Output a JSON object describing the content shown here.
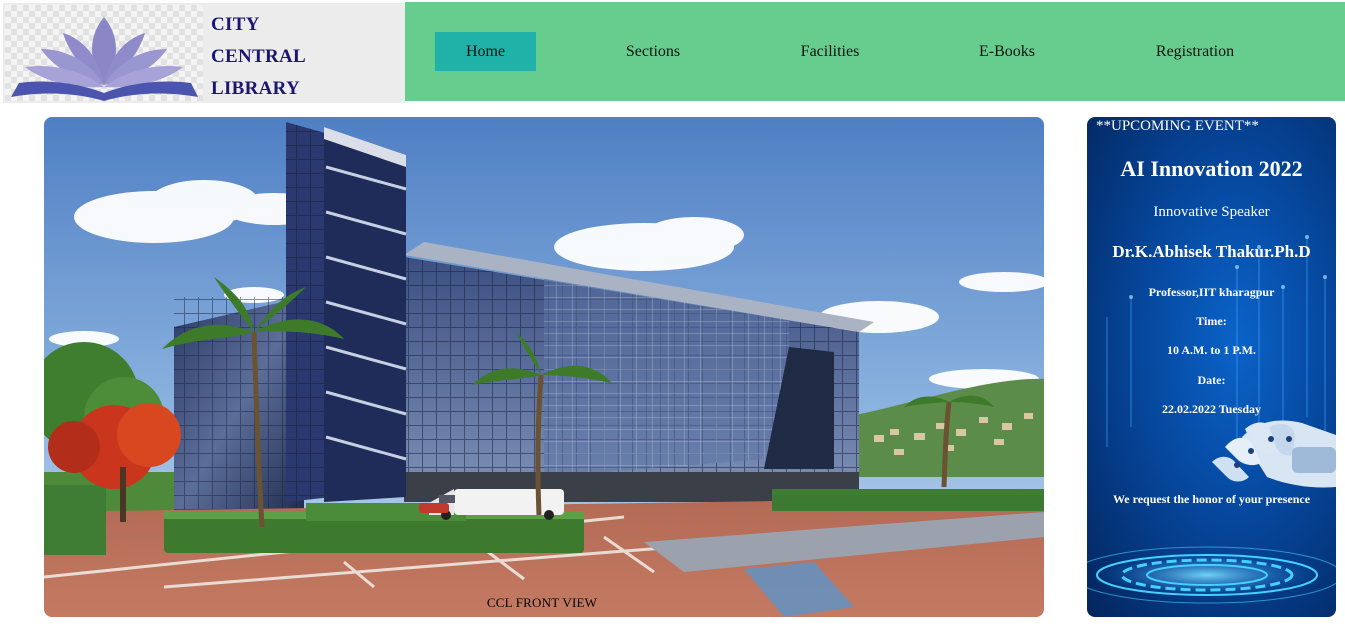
{
  "brand": {
    "line1": "CITY",
    "line2": "CENTRAL",
    "line3": "LIBRARY",
    "logo_icon": "lotus-book-icon",
    "color": "#1c1670"
  },
  "nav": {
    "background": "#66cd8f",
    "active_color": "#20b2a8",
    "items": [
      {
        "label": "Home",
        "active": true
      },
      {
        "label": "Sections",
        "active": false
      },
      {
        "label": "Facilities",
        "active": false
      },
      {
        "label": "E-Books",
        "active": false
      },
      {
        "label": "Registration",
        "active": false
      }
    ]
  },
  "hero": {
    "image": "library-building-photo",
    "caption": "CCL FRONT VIEW"
  },
  "event": {
    "tag": "**UPCOMING EVENT**",
    "title": "AI Innovation 2022",
    "speaker_label": "Innovative Speaker",
    "speaker_name": "Dr.K.Abhisek Thakur.Ph.D",
    "affiliation": "Professor,IIT kharagpur",
    "time_label": "Time:",
    "time_value": "10 A.M. to 1 P.M.",
    "date_label": "Date:",
    "date_value": "22.02.2022 Tuesday",
    "invite": "We request the honor of your presence",
    "background_image": "robot-hand-tech-icon"
  }
}
